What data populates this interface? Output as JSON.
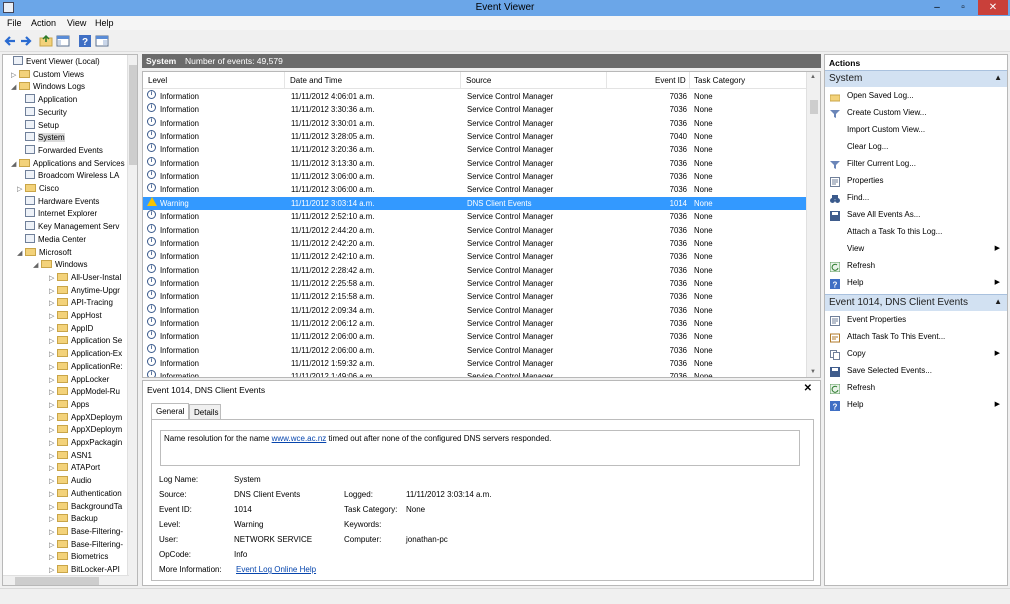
{
  "window": {
    "title": "Event Viewer",
    "minimize": "–",
    "maximize": "▫",
    "close": "✕"
  },
  "menu": [
    "File",
    "Action",
    "View",
    "Help"
  ],
  "tree": {
    "items": [
      {
        "label": "Event Viewer (Local)",
        "level": 0,
        "arrow": "",
        "icon": "log"
      },
      {
        "label": "Custom Views",
        "level": 1,
        "arrow": "▷",
        "icon": "folder"
      },
      {
        "label": "Windows Logs",
        "level": 1,
        "arrow": "◢",
        "icon": "folder"
      },
      {
        "label": "Application",
        "level": 2,
        "arrow": "",
        "icon": "log"
      },
      {
        "label": "Security",
        "level": 2,
        "arrow": "",
        "icon": "log"
      },
      {
        "label": "Setup",
        "level": 2,
        "arrow": "",
        "icon": "log"
      },
      {
        "label": "System",
        "level": 2,
        "arrow": "",
        "icon": "log",
        "selected": true
      },
      {
        "label": "Forwarded Events",
        "level": 2,
        "arrow": "",
        "icon": "log"
      },
      {
        "label": "Applications and Services Lo",
        "level": 1,
        "arrow": "◢",
        "icon": "folder"
      },
      {
        "label": "Broadcom Wireless LA",
        "level": 2,
        "arrow": "",
        "icon": "log"
      },
      {
        "label": "Cisco",
        "level": 2,
        "arrow": "▷",
        "icon": "folder"
      },
      {
        "label": "Hardware Events",
        "level": 2,
        "arrow": "",
        "icon": "log"
      },
      {
        "label": "Internet Explorer",
        "level": 2,
        "arrow": "",
        "icon": "log"
      },
      {
        "label": "Key Management Serv",
        "level": 2,
        "arrow": "",
        "icon": "log"
      },
      {
        "label": "Media Center",
        "level": 2,
        "arrow": "",
        "icon": "log"
      },
      {
        "label": "Microsoft",
        "level": 2,
        "arrow": "◢",
        "icon": "folder"
      },
      {
        "label": "Windows",
        "level": 3,
        "arrow": "◢",
        "icon": "folder"
      },
      {
        "label": "All-User-Instal",
        "level": 4,
        "arrow": "▷",
        "icon": "folder"
      },
      {
        "label": "Anytime-Upgr",
        "level": 4,
        "arrow": "▷",
        "icon": "folder"
      },
      {
        "label": "API-Tracing",
        "level": 4,
        "arrow": "▷",
        "icon": "folder"
      },
      {
        "label": "AppHost",
        "level": 4,
        "arrow": "▷",
        "icon": "folder"
      },
      {
        "label": "AppID",
        "level": 4,
        "arrow": "▷",
        "icon": "folder"
      },
      {
        "label": "Application Se",
        "level": 4,
        "arrow": "▷",
        "icon": "folder"
      },
      {
        "label": "Application-Ex",
        "level": 4,
        "arrow": "▷",
        "icon": "folder"
      },
      {
        "label": "ApplicationRe:",
        "level": 4,
        "arrow": "▷",
        "icon": "folder"
      },
      {
        "label": "AppLocker",
        "level": 4,
        "arrow": "▷",
        "icon": "folder"
      },
      {
        "label": "AppModel-Ru",
        "level": 4,
        "arrow": "▷",
        "icon": "folder"
      },
      {
        "label": "Apps",
        "level": 4,
        "arrow": "▷",
        "icon": "folder"
      },
      {
        "label": "AppXDeploym",
        "level": 4,
        "arrow": "▷",
        "icon": "folder"
      },
      {
        "label": "AppXDeploym",
        "level": 4,
        "arrow": "▷",
        "icon": "folder"
      },
      {
        "label": "AppxPackagin",
        "level": 4,
        "arrow": "▷",
        "icon": "folder"
      },
      {
        "label": "ASN1",
        "level": 4,
        "arrow": "▷",
        "icon": "folder"
      },
      {
        "label": "ATAPort",
        "level": 4,
        "arrow": "▷",
        "icon": "folder"
      },
      {
        "label": "Audio",
        "level": 4,
        "arrow": "▷",
        "icon": "folder"
      },
      {
        "label": "Authentication",
        "level": 4,
        "arrow": "▷",
        "icon": "folder"
      },
      {
        "label": "BackgroundTa",
        "level": 4,
        "arrow": "▷",
        "icon": "folder"
      },
      {
        "label": "Backup",
        "level": 4,
        "arrow": "▷",
        "icon": "folder"
      },
      {
        "label": "Base-Filtering-",
        "level": 4,
        "arrow": "▷",
        "icon": "folder"
      },
      {
        "label": "Base-Filtering-",
        "level": 4,
        "arrow": "▷",
        "icon": "folder"
      },
      {
        "label": "Biometrics",
        "level": 4,
        "arrow": "▷",
        "icon": "folder"
      },
      {
        "label": "BitLocker-API",
        "level": 4,
        "arrow": "▷",
        "icon": "folder"
      }
    ]
  },
  "log": {
    "name": "System",
    "count_label": "Number of events: 49,579"
  },
  "columns": {
    "level": "Level",
    "datetime": "Date and Time",
    "source": "Source",
    "event_id": "Event ID",
    "task": "Task Category"
  },
  "events": [
    {
      "level": "Information",
      "datetime": "11/11/2012 4:06:01 a.m.",
      "source": "Service Control Manager",
      "event_id": "7036",
      "task": "None"
    },
    {
      "level": "Information",
      "datetime": "11/11/2012 3:30:36 a.m.",
      "source": "Service Control Manager",
      "event_id": "7036",
      "task": "None"
    },
    {
      "level": "Information",
      "datetime": "11/11/2012 3:30:01 a.m.",
      "source": "Service Control Manager",
      "event_id": "7036",
      "task": "None"
    },
    {
      "level": "Information",
      "datetime": "11/11/2012 3:28:05 a.m.",
      "source": "Service Control Manager",
      "event_id": "7040",
      "task": "None"
    },
    {
      "level": "Information",
      "datetime": "11/11/2012 3:20:36 a.m.",
      "source": "Service Control Manager",
      "event_id": "7036",
      "task": "None"
    },
    {
      "level": "Information",
      "datetime": "11/11/2012 3:13:30 a.m.",
      "source": "Service Control Manager",
      "event_id": "7036",
      "task": "None"
    },
    {
      "level": "Information",
      "datetime": "11/11/2012 3:06:00 a.m.",
      "source": "Service Control Manager",
      "event_id": "7036",
      "task": "None"
    },
    {
      "level": "Information",
      "datetime": "11/11/2012 3:06:00 a.m.",
      "source": "Service Control Manager",
      "event_id": "7036",
      "task": "None"
    },
    {
      "level": "Warning",
      "datetime": "11/11/2012 3:03:14 a.m.",
      "source": "DNS Client Events",
      "event_id": "1014",
      "task": "None",
      "selected": true
    },
    {
      "level": "Information",
      "datetime": "11/11/2012 2:52:10 a.m.",
      "source": "Service Control Manager",
      "event_id": "7036",
      "task": "None"
    },
    {
      "level": "Information",
      "datetime": "11/11/2012 2:44:20 a.m.",
      "source": "Service Control Manager",
      "event_id": "7036",
      "task": "None"
    },
    {
      "level": "Information",
      "datetime": "11/11/2012 2:42:20 a.m.",
      "source": "Service Control Manager",
      "event_id": "7036",
      "task": "None"
    },
    {
      "level": "Information",
      "datetime": "11/11/2012 2:42:10 a.m.",
      "source": "Service Control Manager",
      "event_id": "7036",
      "task": "None"
    },
    {
      "level": "Information",
      "datetime": "11/11/2012 2:28:42 a.m.",
      "source": "Service Control Manager",
      "event_id": "7036",
      "task": "None"
    },
    {
      "level": "Information",
      "datetime": "11/11/2012 2:25:58 a.m.",
      "source": "Service Control Manager",
      "event_id": "7036",
      "task": "None"
    },
    {
      "level": "Information",
      "datetime": "11/11/2012 2:15:58 a.m.",
      "source": "Service Control Manager",
      "event_id": "7036",
      "task": "None"
    },
    {
      "level": "Information",
      "datetime": "11/11/2012 2:09:34 a.m.",
      "source": "Service Control Manager",
      "event_id": "7036",
      "task": "None"
    },
    {
      "level": "Information",
      "datetime": "11/11/2012 2:06:12 a.m.",
      "source": "Service Control Manager",
      "event_id": "7036",
      "task": "None"
    },
    {
      "level": "Information",
      "datetime": "11/11/2012 2:06:00 a.m.",
      "source": "Service Control Manager",
      "event_id": "7036",
      "task": "None"
    },
    {
      "level": "Information",
      "datetime": "11/11/2012 2:06:00 a.m.",
      "source": "Service Control Manager",
      "event_id": "7036",
      "task": "None"
    },
    {
      "level": "Information",
      "datetime": "11/11/2012 1:59:32 a.m.",
      "source": "Service Control Manager",
      "event_id": "7036",
      "task": "None"
    },
    {
      "level": "Information",
      "datetime": "11/11/2012 1:49:06 a.m.",
      "source": "Service Control Manager",
      "event_id": "7036",
      "task": "None"
    }
  ],
  "detail": {
    "title": "Event 1014, DNS Client Events",
    "tabs": [
      "General",
      "Details"
    ],
    "desc_prefix": "Name resolution for the name ",
    "desc_link": "www.wce.ac.nz",
    "desc_suffix": " timed out after none of the configured DNS servers responded.",
    "labels": {
      "log_name": "Log Name:",
      "source": "Source:",
      "event_id": "Event ID:",
      "level": "Level:",
      "user": "User:",
      "opcode": "OpCode:",
      "more_info": "More Information:",
      "logged": "Logged:",
      "task_category": "Task Category:",
      "keywords": "Keywords:",
      "computer": "Computer:"
    },
    "values": {
      "log_name": "System",
      "source": "DNS Client Events",
      "event_id": "1014",
      "level": "Warning",
      "user": "NETWORK SERVICE",
      "opcode": "Info",
      "more_info": "Event Log Online Help",
      "logged": "11/11/2012 3:03:14 a.m.",
      "task_category": "None",
      "keywords": "",
      "computer": "jonathan-pc"
    }
  },
  "actions": {
    "header": "Actions",
    "sections": [
      {
        "title": "System",
        "items": [
          {
            "label": "Open Saved Log...",
            "icon": "open-folder-icon"
          },
          {
            "label": "Create Custom View...",
            "icon": "filter-icon"
          },
          {
            "label": "Import Custom View...",
            "icon": "blank-icon"
          },
          {
            "label": "Clear Log...",
            "icon": "blank-icon"
          },
          {
            "label": "Filter Current Log...",
            "icon": "filter-icon"
          },
          {
            "label": "Properties",
            "icon": "properties-icon"
          },
          {
            "label": "Find...",
            "icon": "binoculars-icon"
          },
          {
            "label": "Save All Events As...",
            "icon": "save-icon"
          },
          {
            "label": "Attach a Task To this Log...",
            "icon": "blank-icon"
          },
          {
            "label": "View",
            "icon": "blank-icon",
            "submenu": true
          },
          {
            "label": "Refresh",
            "icon": "refresh-icon"
          },
          {
            "label": "Help",
            "icon": "help-icon",
            "submenu": true
          }
        ]
      },
      {
        "title": "Event 1014, DNS Client Events",
        "items": [
          {
            "label": "Event Properties",
            "icon": "properties-icon"
          },
          {
            "label": "Attach Task To This Event...",
            "icon": "task-icon"
          },
          {
            "label": "Copy",
            "icon": "copy-icon",
            "submenu": true
          },
          {
            "label": "Save Selected Events...",
            "icon": "save-icon"
          },
          {
            "label": "Refresh",
            "icon": "refresh-icon"
          },
          {
            "label": "Help",
            "icon": "help-icon",
            "submenu": true
          }
        ]
      }
    ]
  },
  "colors": {
    "titlebar": "#6ba6e8",
    "selection": "#3399ff",
    "section_header": "#d2e1f2",
    "warning": "#f5c400"
  }
}
